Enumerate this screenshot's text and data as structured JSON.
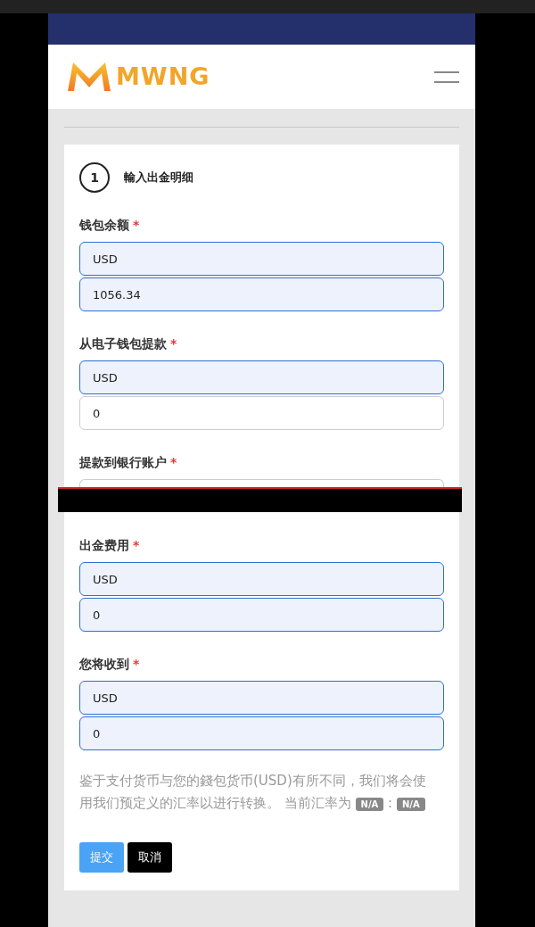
{
  "header": {
    "brand": "MWNG"
  },
  "step": {
    "number": "1",
    "title": "輸入出金明细"
  },
  "groups": [
    {
      "label": "钱包余额",
      "required_mark": "*",
      "fields": [
        {
          "kind": "input",
          "value": "USD",
          "readonly": true
        },
        {
          "kind": "input",
          "value": "1056.34",
          "readonly": true
        }
      ]
    },
    {
      "label": "从电子钱包提款",
      "required_mark": "*",
      "fields": [
        {
          "kind": "input",
          "value": "USD",
          "readonly": true
        },
        {
          "kind": "input",
          "value": "0",
          "readonly": false
        }
      ]
    },
    {
      "label": "提款到银行账户",
      "required_mark": "*",
      "fields": [
        {
          "kind": "redacted"
        }
      ]
    },
    {
      "label": "出金费用",
      "required_mark": "*",
      "fields": [
        {
          "kind": "input",
          "value": "USD",
          "readonly": true
        },
        {
          "kind": "input",
          "value": "0",
          "readonly": true
        }
      ]
    },
    {
      "label": "您将收到",
      "required_mark": "*",
      "fields": [
        {
          "kind": "input",
          "value": "USD",
          "readonly": true
        },
        {
          "kind": "input",
          "value": "0",
          "readonly": true
        }
      ]
    }
  ],
  "note": {
    "text": "鉴于支付货币与您的錢包货币(USD)有所不同，我们将会使用我们预定义的汇率以进行转换。 当前汇率为",
    "rate_from": "N/A",
    "separator": ":",
    "rate_to": "N/A"
  },
  "buttons": [
    {
      "kind": "primary",
      "label": "提交"
    },
    {
      "kind": "dark",
      "label": "取消"
    }
  ]
}
